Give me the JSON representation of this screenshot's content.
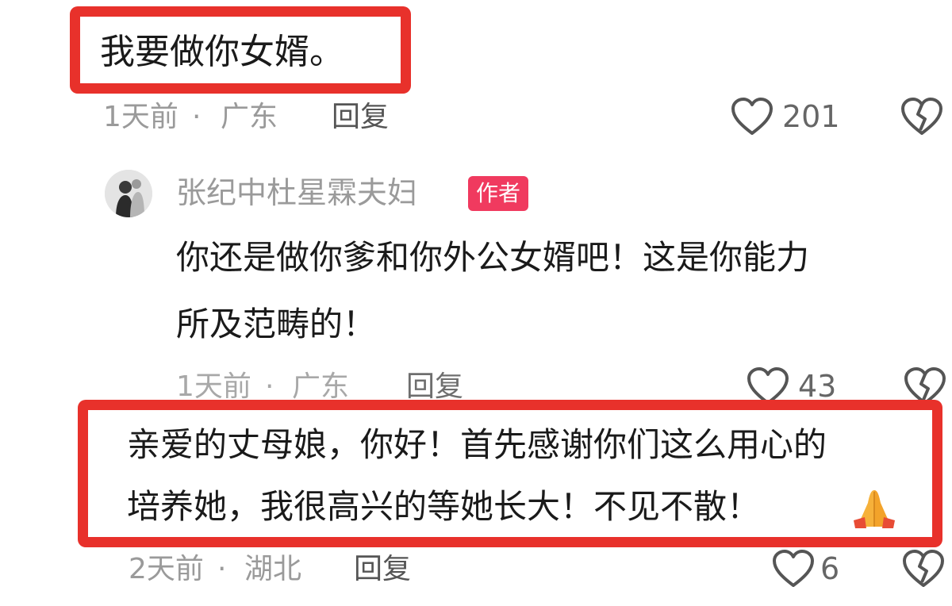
{
  "comment1": {
    "text": "我要做你女婿。",
    "time": "1天前",
    "sep": "·",
    "location": "广东",
    "reply_label": "回复",
    "likes": "201"
  },
  "reply1": {
    "username": "张纪中杜星霖夫妇",
    "badge": "作者",
    "line1": "你还是做你爹和你外公女婿吧！这是你能力",
    "line2": "所及范畴的！",
    "time": "1天前",
    "sep": "·",
    "location": "广东",
    "reply_label": "回复",
    "likes": "43"
  },
  "comment2": {
    "line1": "亲爱的丈母娘，你好！首先感谢你们这么用心的",
    "line2": "培养她，我很高兴的等她长大！不见不散！",
    "emoji": "🙏",
    "time": "2天前",
    "sep": "·",
    "location": "湖北",
    "reply_label": "回复",
    "likes": "6"
  },
  "icons": {
    "like": "heart-outline-icon",
    "dislike": "broken-heart-icon",
    "pray": "praying-hands-emoji"
  },
  "colors": {
    "highlight": "#e8312b",
    "author_badge": "#f03a5f",
    "meta": "#9a9a9a"
  }
}
